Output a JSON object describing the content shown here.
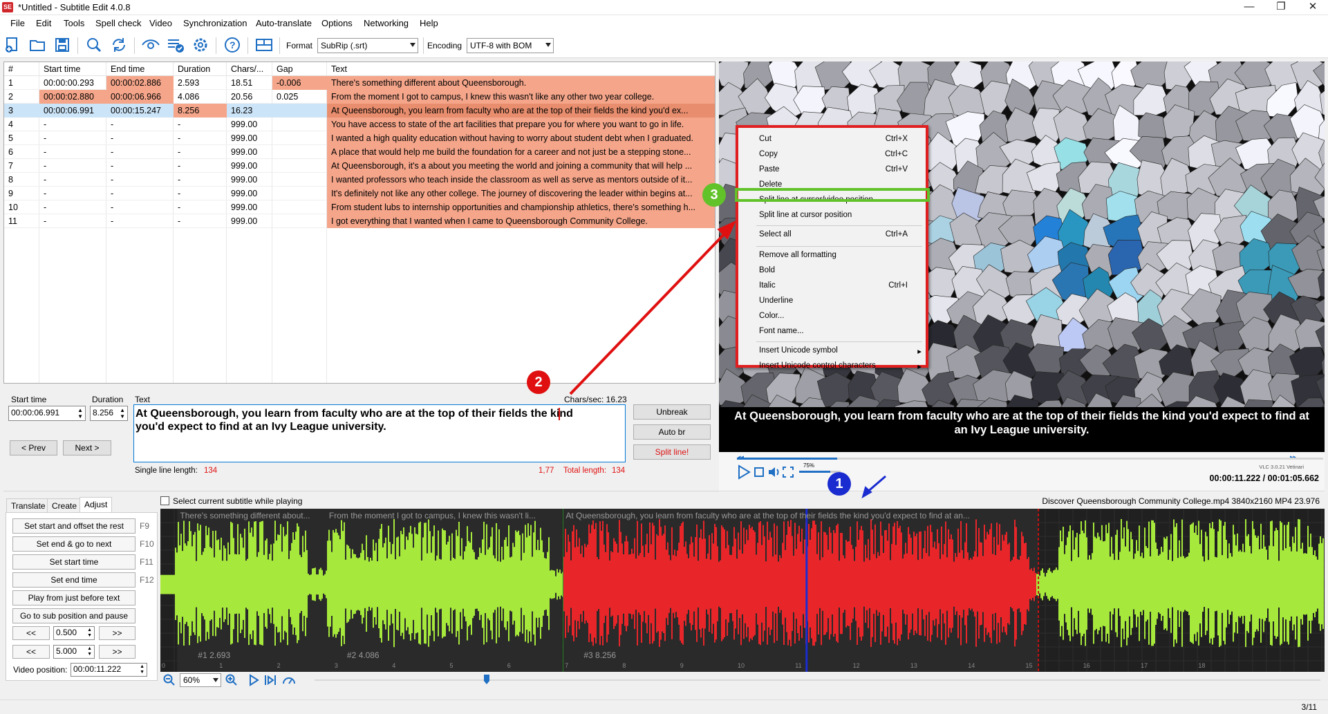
{
  "window": {
    "title": "*Untitled - Subtitle Edit 4.0.8",
    "app_icon": "SE"
  },
  "menu": [
    "File",
    "Edit",
    "Tools",
    "Spell check",
    "Video",
    "Synchronization",
    "Auto-translate",
    "Options",
    "Networking",
    "Help"
  ],
  "toolbar": {
    "format_label": "Format",
    "format_value": "SubRip (.srt)",
    "encoding_label": "Encoding",
    "encoding_value": "UTF-8 with BOM"
  },
  "grid": {
    "headers": [
      "#",
      "Start time",
      "End time",
      "Duration",
      "Chars/...",
      "Gap",
      "Text"
    ],
    "rows": [
      [
        "1",
        "00:00:00.293",
        "00:00:02.886",
        "2.593",
        "18.51",
        "-0.006",
        "There's something different about Queensborough."
      ],
      [
        "2",
        "00:00:02.880",
        "00:00:06.966",
        "4.086",
        "20.56",
        "0.025",
        "From the moment I got to campus, I knew this wasn't like any other two year college."
      ],
      [
        "3",
        "00:00:06.991",
        "00:00:15.247",
        "8.256",
        "16.23",
        "",
        "At Queensborough, you learn from faculty who are at the top of their fields the kind you'd ex..."
      ],
      [
        "4",
        "-",
        "-",
        "-",
        "999.00",
        "",
        "You have access to state of the art facilities that prepare you for where you want to go in life."
      ],
      [
        "5",
        "-",
        "-",
        "-",
        "999.00",
        "",
        "I wanted a high quality education without having to worry about student debt when I graduated."
      ],
      [
        "6",
        "-",
        "-",
        "-",
        "999.00",
        "",
        "A place that would help me build the foundation for a career and not just be a stepping stone..."
      ],
      [
        "7",
        "-",
        "-",
        "-",
        "999.00",
        "",
        "At Queensborough, it's a about you meeting the world and joining a community that will help ..."
      ],
      [
        "8",
        "-",
        "-",
        "-",
        "999.00",
        "",
        "I wanted professors who teach inside the classroom as well as serve as mentors outside of it..."
      ],
      [
        "9",
        "-",
        "-",
        "-",
        "999.00",
        "",
        "It's definitely not like any other college. The journey of discovering the leader within begins at..."
      ],
      [
        "10",
        "-",
        "-",
        "-",
        "999.00",
        "",
        "From student lubs to internship opportunities and championship athletics, there's something h..."
      ],
      [
        "11",
        "-",
        "-",
        "-",
        "999.00",
        "",
        "I got everything that I wanted when I came to Queensborough Community College."
      ]
    ],
    "highlight_color": "#f4a58a",
    "selected_color": "#cce4f7"
  },
  "context_menu": {
    "items": [
      {
        "label": "Cut",
        "shortcut": "Ctrl+X"
      },
      {
        "label": "Copy",
        "shortcut": "Ctrl+C"
      },
      {
        "label": "Paste",
        "shortcut": "Ctrl+V"
      },
      {
        "label": "Delete",
        "shortcut": ""
      },
      {
        "label": "Split line at cursor/video position",
        "shortcut": ""
      },
      {
        "label": "Split line at cursor position",
        "shortcut": ""
      },
      {
        "label": "Select all",
        "shortcut": "Ctrl+A"
      },
      {
        "label": "Remove all formatting",
        "shortcut": ""
      },
      {
        "label": "Bold",
        "shortcut": ""
      },
      {
        "label": "Italic",
        "shortcut": "Ctrl+I"
      },
      {
        "label": "Underline",
        "shortcut": ""
      },
      {
        "label": "Color...",
        "shortcut": ""
      },
      {
        "label": "Font name...",
        "shortcut": ""
      },
      {
        "label": "Insert Unicode symbol",
        "shortcut": "▸"
      },
      {
        "label": "Insert Unicode control characters",
        "shortcut": "▸"
      }
    ]
  },
  "video": {
    "subtitle_line1": "At Queensborough, you learn from faculty who are at the top of their fields the kind you'd expect to find at",
    "subtitle_line2": "an Ivy League university.",
    "volume": "75%",
    "vlc": "VLC 3.0.21 Vetinari",
    "time": "00:00:11.222 / 00:01:05.662",
    "progress": 0.171
  },
  "edit": {
    "start_label": "Start time",
    "start_value": "00:00:06.991",
    "duration_label": "Duration",
    "duration_value": "8.256",
    "text_label": "Text",
    "chars_sec": "Chars/sec: 16.23",
    "text_line1": "At Queensborough, you learn from faculty who are at the top of their fields the kind",
    "text_line2": "you'd expect to find at an Ivy League university.",
    "prev": "< Prev",
    "next": "Next >",
    "unbreak": "Unbreak",
    "auto_br": "Auto br",
    "split": "Split line!",
    "single_line_label": "Single line length:",
    "single_line_value": "134",
    "pos": "1,77",
    "total_label": "Total length:",
    "total_value": "134"
  },
  "bottom": {
    "tabs": [
      "Translate",
      "Create",
      "Adjust"
    ],
    "select_current": "Select current subtitle while playing",
    "file_info": "Discover Queensborough Community College.mp4 3840x2160 MP4 23.976",
    "adjust_buttons": [
      {
        "label": "Set start and offset the rest",
        "key": "F9"
      },
      {
        "label": "Set end & go to next",
        "key": "F10"
      },
      {
        "label": "Set start time",
        "key": "F11"
      },
      {
        "label": "Set end time",
        "key": "F12"
      },
      {
        "label": "Play from just before text",
        "key": ""
      },
      {
        "label": "Go to sub position and pause",
        "key": ""
      }
    ],
    "step1": "0.500",
    "step2": "5.000",
    "back": "<<",
    "fwd": ">>",
    "video_pos_label": "Video position:",
    "video_pos_value": "00:00:11.222",
    "zoom": "60%",
    "status": "3/11"
  },
  "waveform": {
    "segments": [
      {
        "text": "There's something different about...",
        "label": "#1  2.693"
      },
      {
        "text": "From the moment I got to campus, I knew this wasn't li...",
        "label": "#2  4.086"
      },
      {
        "text": "At Queensborough, you learn from faculty who are at the top of their fields the kind you'd expect to find at an...",
        "label": "#3  8.256"
      }
    ],
    "ticks": [
      "0",
      "1",
      "2",
      "3",
      "4",
      "5",
      "6",
      "7",
      "8",
      "9",
      "10",
      "11",
      "12",
      "13",
      "14",
      "15",
      "16",
      "17",
      "18"
    ],
    "green": "#a6e83c",
    "red": "#e8262a"
  },
  "annotations": {
    "badge1": "1",
    "badge2": "2",
    "badge3": "3"
  }
}
